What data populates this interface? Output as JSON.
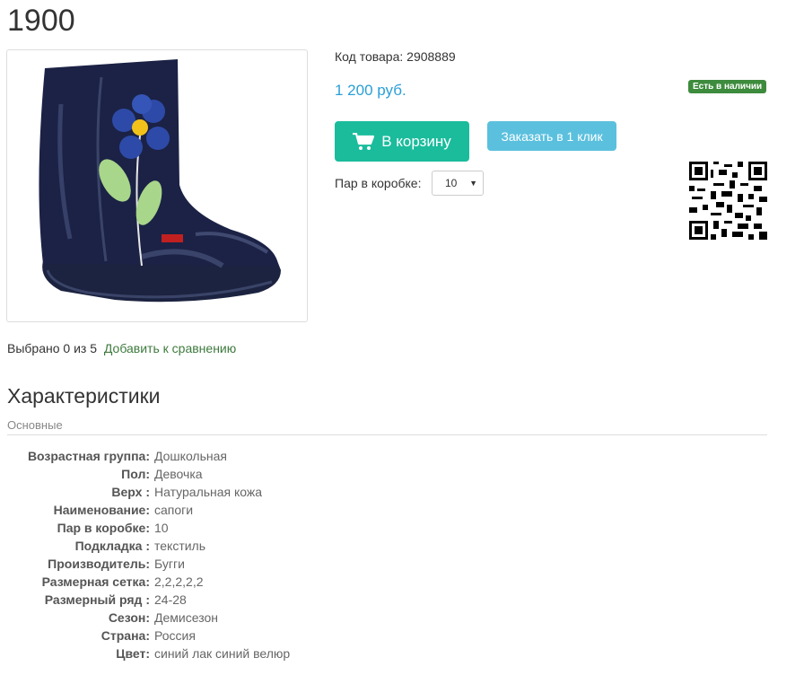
{
  "product": {
    "title": "1900",
    "code_text": "Код товара: 2908889",
    "price": "1 200 руб.",
    "stock_badge": "Есть в наличии"
  },
  "actions": {
    "cart_label": "В корзину",
    "oneclick_label": "Заказать в 1 клик"
  },
  "pairs": {
    "label": "Пар в коробке:",
    "selected": "10"
  },
  "compare": {
    "selected_text": "Выбрано 0 из 5",
    "link_label": "Добавить к сравнению"
  },
  "characteristics": {
    "title": "Характеристики",
    "group": "Основные",
    "rows": [
      {
        "key": "Возрастная группа:",
        "value": "Дошкольная"
      },
      {
        "key": "Пол:",
        "value": "Девочка"
      },
      {
        "key": "Верх :",
        "value": "Натуральная кожа"
      },
      {
        "key": "Наименование:",
        "value": "сапоги"
      },
      {
        "key": "Пар в коробке:",
        "value": "10"
      },
      {
        "key": "Подкладка :",
        "value": "текстиль"
      },
      {
        "key": "Производитель:",
        "value": "Бугги"
      },
      {
        "key": "Размерная сетка:",
        "value": "2,2,2,2,2"
      },
      {
        "key": "Размерный ряд :",
        "value": "24-28"
      },
      {
        "key": "Сезон:",
        "value": "Демисезон"
      },
      {
        "key": "Страна:",
        "value": "Россия"
      },
      {
        "key": "Цвет:",
        "value": "синий лак синий велюр"
      }
    ]
  },
  "colors": {
    "price": "#2a9fd6",
    "cart_button": "#1abc9c",
    "oneclick_button": "#5bc0de",
    "stock_badge": "#3d8b3d",
    "compare_link": "#3d7a3d"
  },
  "icons": {
    "cart": "shopping-cart-icon",
    "select_caret": "caret-down-icon",
    "qr": "qr-code-icon"
  }
}
